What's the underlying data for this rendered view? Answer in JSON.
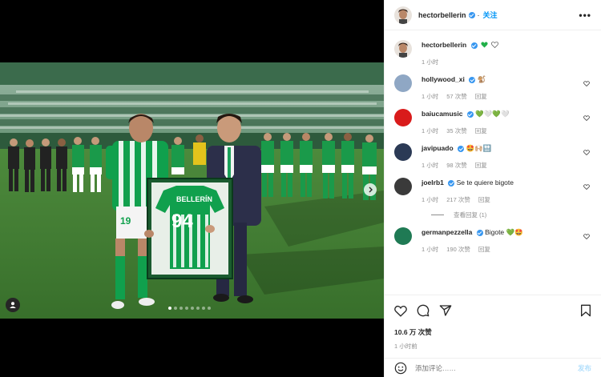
{
  "post": {
    "author": "hectorbellerin",
    "follow_label": "关注",
    "follow_separator": "·",
    "more_label": "•••",
    "caption_time": "1 小时",
    "likes": "10.6 万 次赞",
    "posted_time": "1 小时前",
    "add_comment_placeholder": "添加评论……",
    "post_label": "发布",
    "carousel_dots": 8,
    "carousel_active_index": 0
  },
  "photo": {
    "jersey_name": "BELLERÍN",
    "jersey_number": "94",
    "player_number": "19"
  },
  "comments": [
    {
      "user": "hollywood_xi",
      "verified": true,
      "text": "🐒",
      "time": "1 小时",
      "likes": "57 次赞",
      "reply": "回复",
      "avatar_color": "#8fa7c4"
    },
    {
      "user": "baiucamusic",
      "verified": true,
      "text": "💚🤍💚🤍",
      "time": "1 小时",
      "likes": "35 次赞",
      "reply": "回复",
      "avatar_color": "#d91b1b"
    },
    {
      "user": "javipuado",
      "verified": true,
      "text": "🤩🙌🏼🔛",
      "time": "1 小时",
      "likes": "98 次赞",
      "reply": "回复",
      "avatar_color": "#2b3a55"
    },
    {
      "user": "joelrb1",
      "verified": true,
      "text": "Se te quiere bigote",
      "time": "1 小时",
      "likes": "217 次赞",
      "reply": "回复",
      "avatar_color": "#3a3a3a"
    },
    {
      "user": "germanpezzella",
      "verified": true,
      "text": "Bigote 💚🤩",
      "time": "1 小时",
      "likes": "190 次赞",
      "reply": "回复",
      "avatar_color": "#1f7a54"
    }
  ],
  "view_replies": "查看回复 (1)",
  "colors": {
    "accent": "#0095f6",
    "verified": "#3897f0",
    "betis_green": "#0b9a4a"
  }
}
